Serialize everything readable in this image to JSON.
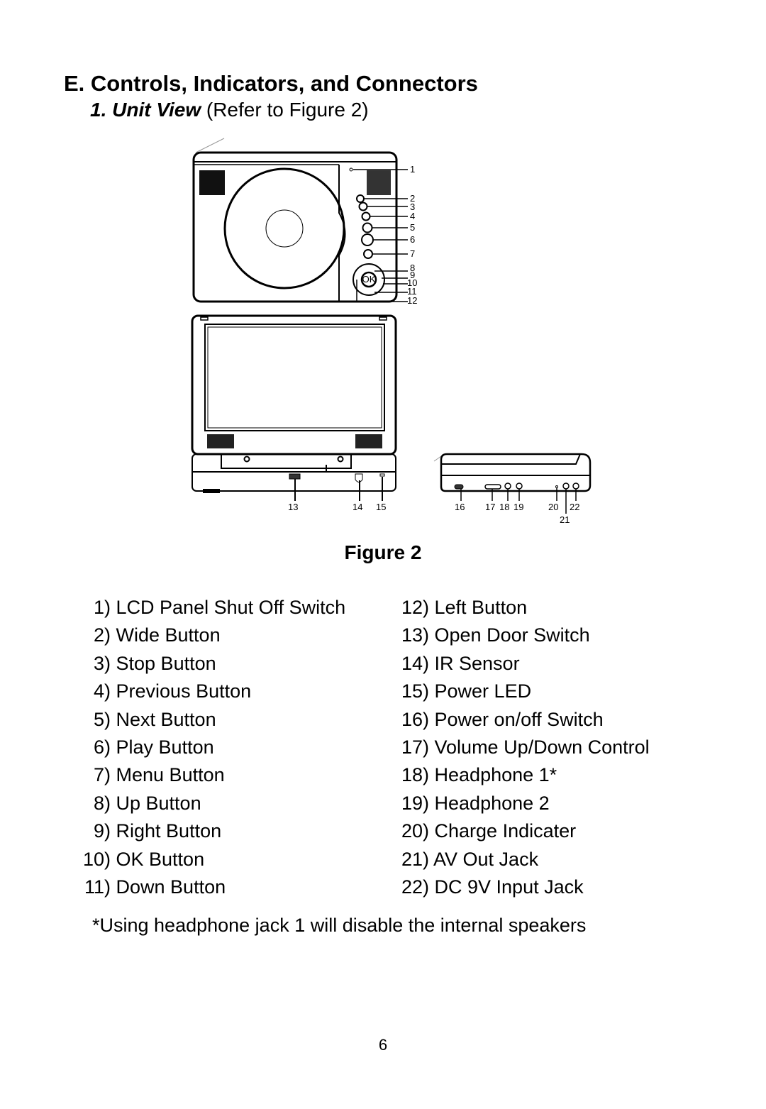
{
  "heading": "E. Controls, Indicators, and Connectors",
  "subtitle": {
    "emphasis": "1. Unit View",
    "rest": " (Refer to Figure 2)"
  },
  "figure": {
    "label": "Figure 2",
    "callouts_top": [
      "1",
      "2",
      "3",
      "4",
      "5",
      "6",
      "7",
      "8",
      "9",
      "10",
      "11",
      "12"
    ],
    "callouts_bottom": [
      "13",
      "14",
      "15",
      "16",
      "17",
      "18",
      "19",
      "20",
      "21",
      "22"
    ],
    "ok_label": "OK"
  },
  "items_left": [
    {
      "num": "1)",
      "label": "LCD Panel Shut Off Switch"
    },
    {
      "num": "2)",
      "label": "Wide Button"
    },
    {
      "num": "3)",
      "label": "Stop Button"
    },
    {
      "num": "4)",
      "label": "Previous Button"
    },
    {
      "num": "5)",
      "label": "Next Button"
    },
    {
      "num": "6)",
      "label": "Play Button"
    },
    {
      "num": "7)",
      "label": "Menu Button"
    },
    {
      "num": "8)",
      "label": "Up Button"
    },
    {
      "num": "9)",
      "label": "Right Button"
    },
    {
      "num": "10)",
      "label": "OK Button"
    },
    {
      "num": "11)",
      "label": "Down Button"
    }
  ],
  "items_right": [
    {
      "num": "12)",
      "label": "Left Button"
    },
    {
      "num": "13)",
      "label": "Open Door Switch"
    },
    {
      "num": "14)",
      "label": "IR Sensor"
    },
    {
      "num": "15)",
      "label": "Power LED"
    },
    {
      "num": "16)",
      "label": "Power on/off Switch"
    },
    {
      "num": "17)",
      "label": "Volume Up/Down Control"
    },
    {
      "num": "18)",
      "label": "Headphone 1*"
    },
    {
      "num": "19)",
      "label": "Headphone 2"
    },
    {
      "num": "20)",
      "label": "Charge Indicater"
    },
    {
      "num": "21)",
      "label": "AV Out Jack"
    },
    {
      "num": "22)",
      "label": "DC 9V Input Jack"
    }
  ],
  "footnote": "*Using headphone jack 1 will disable the internal  speakers",
  "page_number": "6"
}
